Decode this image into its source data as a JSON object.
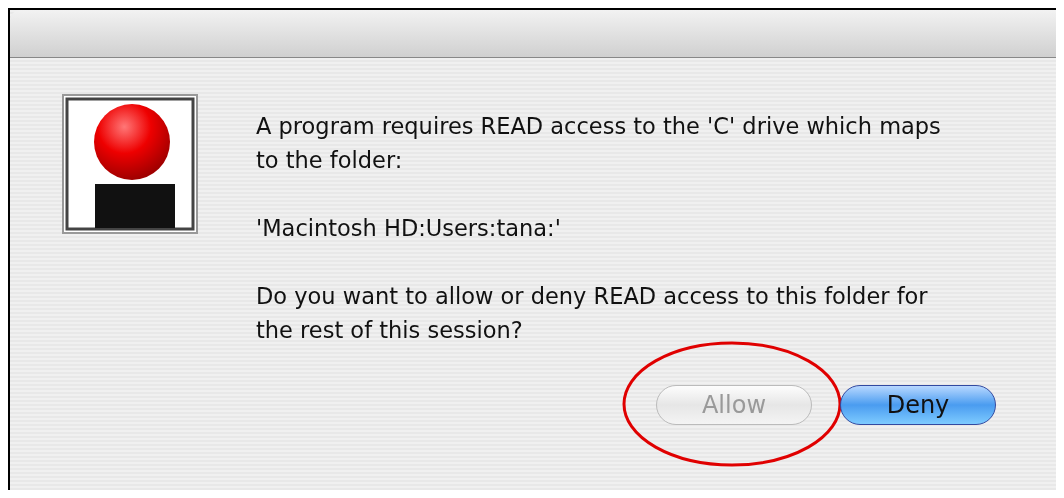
{
  "dialog": {
    "paragraphs": [
      "A program requires READ access to the 'C' drive which maps to the folder:",
      "'Macintosh HD:Users:tana:'",
      "Do you want to allow or deny READ access to this folder for the rest of this session?"
    ],
    "buttons": [
      {
        "label": "Allow",
        "disabled": true,
        "default": false,
        "circled": true
      },
      {
        "label": "Deny",
        "disabled": false,
        "default": true,
        "circled": false
      }
    ]
  }
}
